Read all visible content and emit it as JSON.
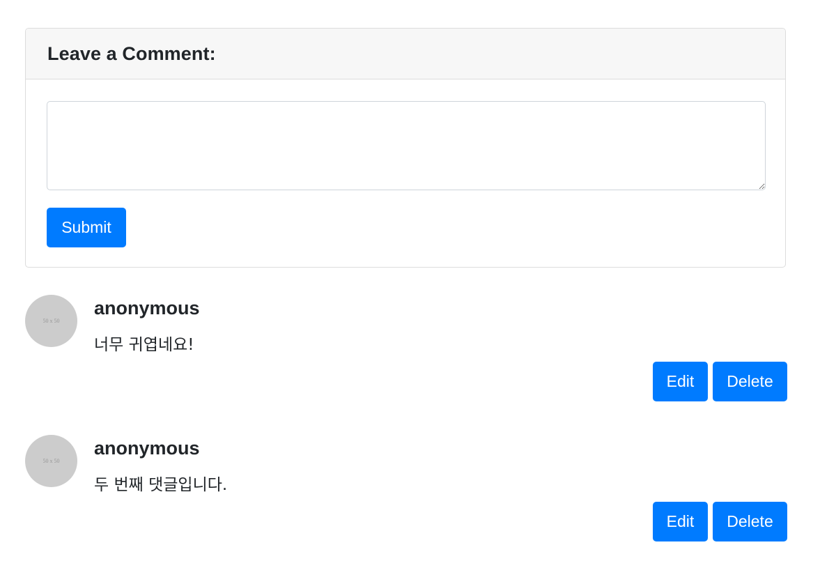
{
  "comment_form": {
    "title": "Leave a Comment:",
    "textarea_value": "",
    "submit_label": "Submit"
  },
  "comments": [
    {
      "author": "anonymous",
      "avatar_text": "50 x 50",
      "text": "너무 귀엽네요!",
      "edit_label": "Edit",
      "delete_label": "Delete"
    },
    {
      "author": "anonymous",
      "avatar_text": "50 x 50",
      "text": "두 번째 댓글입니다.",
      "edit_label": "Edit",
      "delete_label": "Delete"
    }
  ],
  "colors": {
    "primary": "#007bff",
    "header_bg": "#f7f7f7",
    "avatar_bg": "#cccccc",
    "border": "#dcdcdc"
  }
}
